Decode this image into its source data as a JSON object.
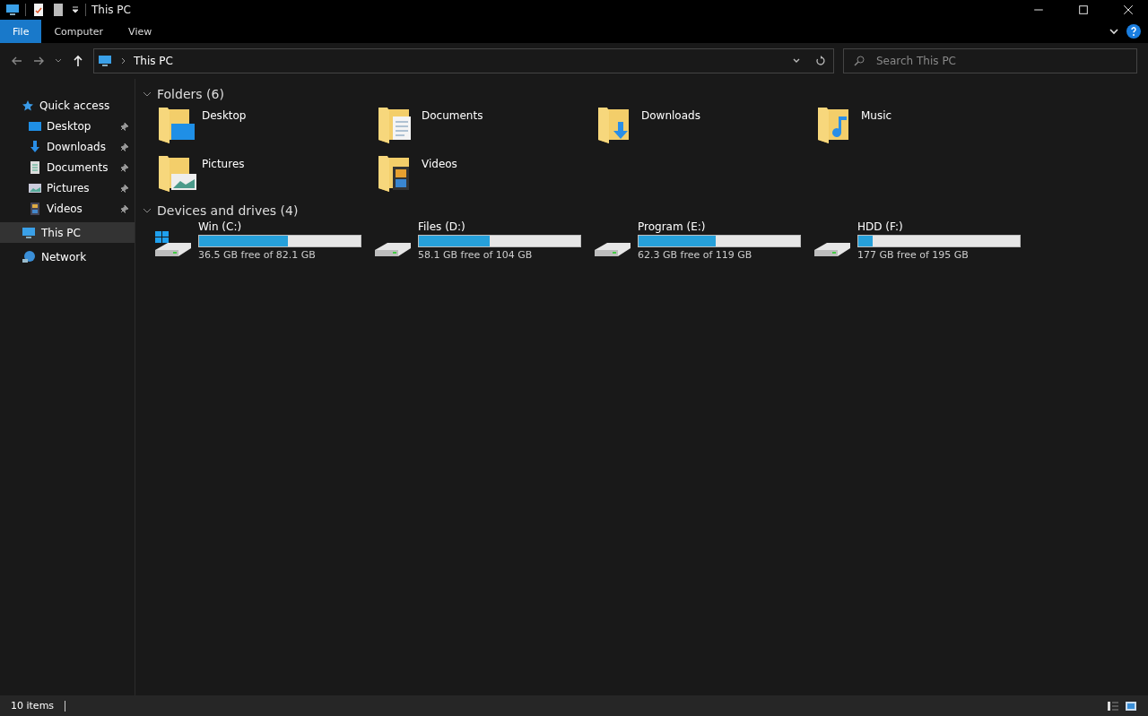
{
  "window": {
    "title": "This PC"
  },
  "ribbon_tabs": [
    {
      "label": "File",
      "selected": true
    },
    {
      "label": "Computer",
      "selected": false
    },
    {
      "label": "View",
      "selected": false
    }
  ],
  "address": {
    "path": "This PC"
  },
  "search": {
    "placeholder": "Search This PC"
  },
  "sidebar": {
    "items": [
      {
        "label": "Quick access",
        "kind": "star",
        "selected": false,
        "children": [
          {
            "label": "Desktop",
            "kind": "desktop",
            "pinned": true,
            "selected": false
          },
          {
            "label": "Downloads",
            "kind": "downloads",
            "pinned": true,
            "selected": false
          },
          {
            "label": "Documents",
            "kind": "documents",
            "pinned": true,
            "selected": false
          },
          {
            "label": "Pictures",
            "kind": "pictures",
            "pinned": true,
            "selected": false
          },
          {
            "label": "Videos",
            "kind": "videos",
            "pinned": true,
            "selected": false
          }
        ]
      },
      {
        "label": "This PC",
        "kind": "pc",
        "selected": true
      },
      {
        "label": "Network",
        "kind": "network",
        "selected": false
      }
    ]
  },
  "sections": [
    {
      "title": "Folders (6)",
      "kind": "folders",
      "items": [
        {
          "name": "Desktop",
          "kind": "desktop"
        },
        {
          "name": "Documents",
          "kind": "documents"
        },
        {
          "name": "Downloads",
          "kind": "downloads"
        },
        {
          "name": "Music",
          "kind": "music"
        },
        {
          "name": "Pictures",
          "kind": "pictures"
        },
        {
          "name": "Videos",
          "kind": "videos"
        }
      ]
    },
    {
      "title": "Devices and drives (4)",
      "kind": "drives",
      "items": [
        {
          "name": "Win (C:)",
          "kind": "system",
          "level": 0.55,
          "free": "36.5 GB free of 82.1 GB"
        },
        {
          "name": "Files (D:)",
          "kind": "plain",
          "level": 0.44,
          "free": "58.1 GB free of 104 GB"
        },
        {
          "name": "Program (E:)",
          "kind": "plain",
          "level": 0.48,
          "free": "62.3 GB free of 119 GB"
        },
        {
          "name": "HDD (F:)",
          "kind": "plain",
          "level": 0.09,
          "free": "177 GB free of 195 GB"
        }
      ]
    }
  ],
  "status_bar": {
    "count": "10 items"
  }
}
